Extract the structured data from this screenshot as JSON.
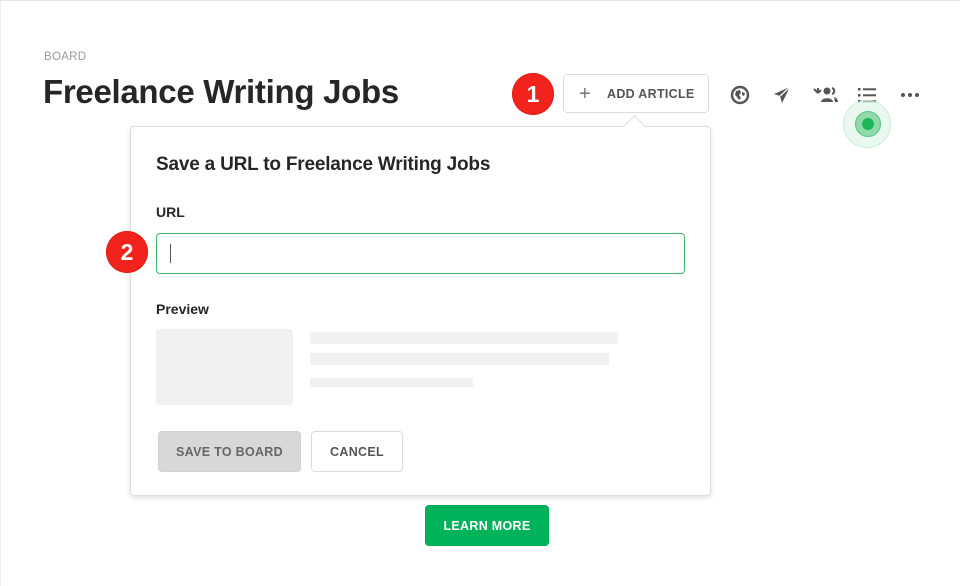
{
  "header": {
    "eyebrow": "BOARD",
    "title": "Freelance Writing Jobs"
  },
  "annotations": {
    "step1": "1",
    "step2": "2"
  },
  "toolbar": {
    "add_article_icon": "+",
    "add_article_label": "ADD ARTICLE",
    "icons": [
      "globe-icon",
      "send-icon",
      "collaborators-icon",
      "list-view-icon",
      "more-icon"
    ]
  },
  "popover": {
    "title": "Save a URL to Freelance Writing Jobs",
    "url_label": "URL",
    "url_value": "",
    "url_placeholder": "",
    "preview_label": "Preview",
    "save_label": "SAVE TO BOARD",
    "cancel_label": "CANCEL"
  },
  "page": {
    "learn_more_label": "LEARN MORE"
  },
  "colors": {
    "accent_green": "#00b259",
    "badge_red": "#f2231c",
    "input_focus_border": "#3db665"
  }
}
